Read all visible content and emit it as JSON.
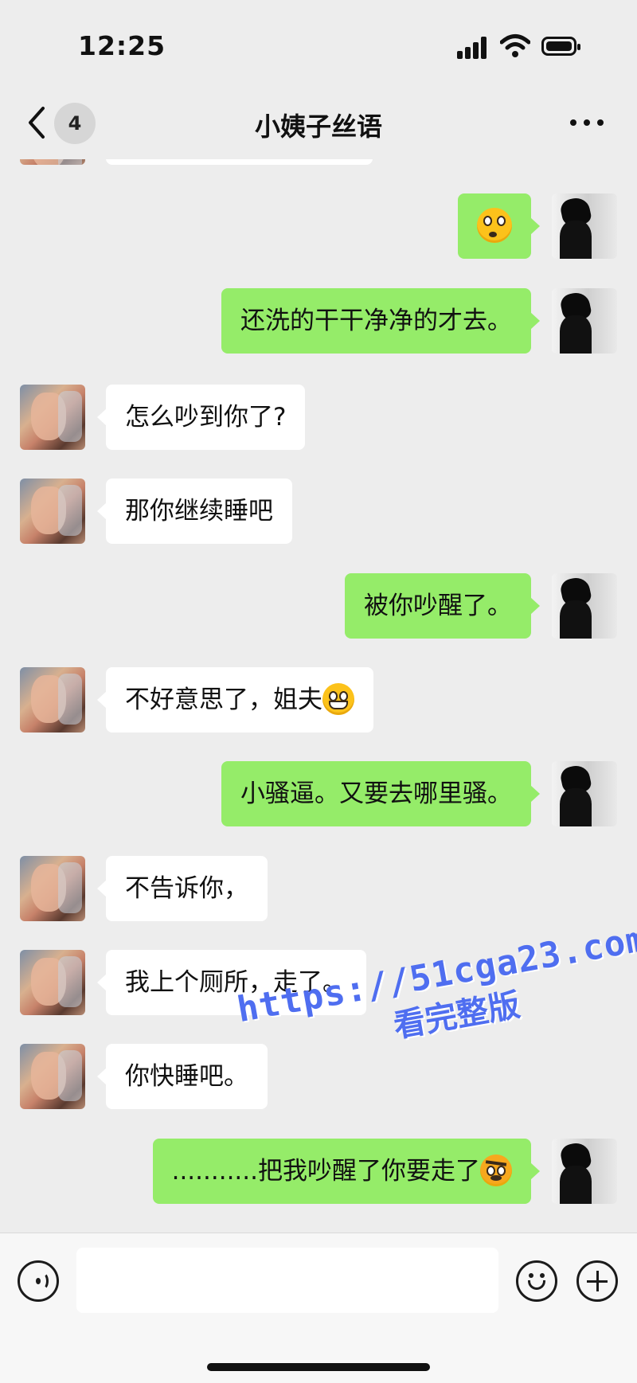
{
  "status_bar": {
    "time": "12:25"
  },
  "nav": {
    "back_badge": "4",
    "title": "小姨子丝语"
  },
  "messages": [
    {
      "side": "out",
      "text": "",
      "emoji": "flushed-emoji"
    },
    {
      "side": "out",
      "text": "还洗的干干净净的才去。"
    },
    {
      "side": "in",
      "text": "怎么吵到你了?"
    },
    {
      "side": "in",
      "text": "那你继续睡吧"
    },
    {
      "side": "out",
      "text": "被你吵醒了。"
    },
    {
      "side": "in",
      "text": "不好意思了，姐夫",
      "emoji": "grimace-emoji"
    },
    {
      "side": "out",
      "text": "小骚逼。又要去哪里骚。"
    },
    {
      "side": "in",
      "text": "不告诉你，"
    },
    {
      "side": "in",
      "text": "我上个厕所，走了。"
    },
    {
      "side": "in",
      "text": "你快睡吧。"
    },
    {
      "side": "out",
      "text": "...........把我吵醒了你要走了",
      "emoji": "angry-emoji"
    }
  ],
  "watermark": {
    "line1": "https://51cga23.com",
    "line2": "看完整版"
  },
  "input": {
    "value": "",
    "placeholder": ""
  },
  "colors": {
    "background": "#ededed",
    "incoming_bubble": "#ffffff",
    "outgoing_bubble": "#95ec69",
    "watermark": "#4f6ef0"
  }
}
